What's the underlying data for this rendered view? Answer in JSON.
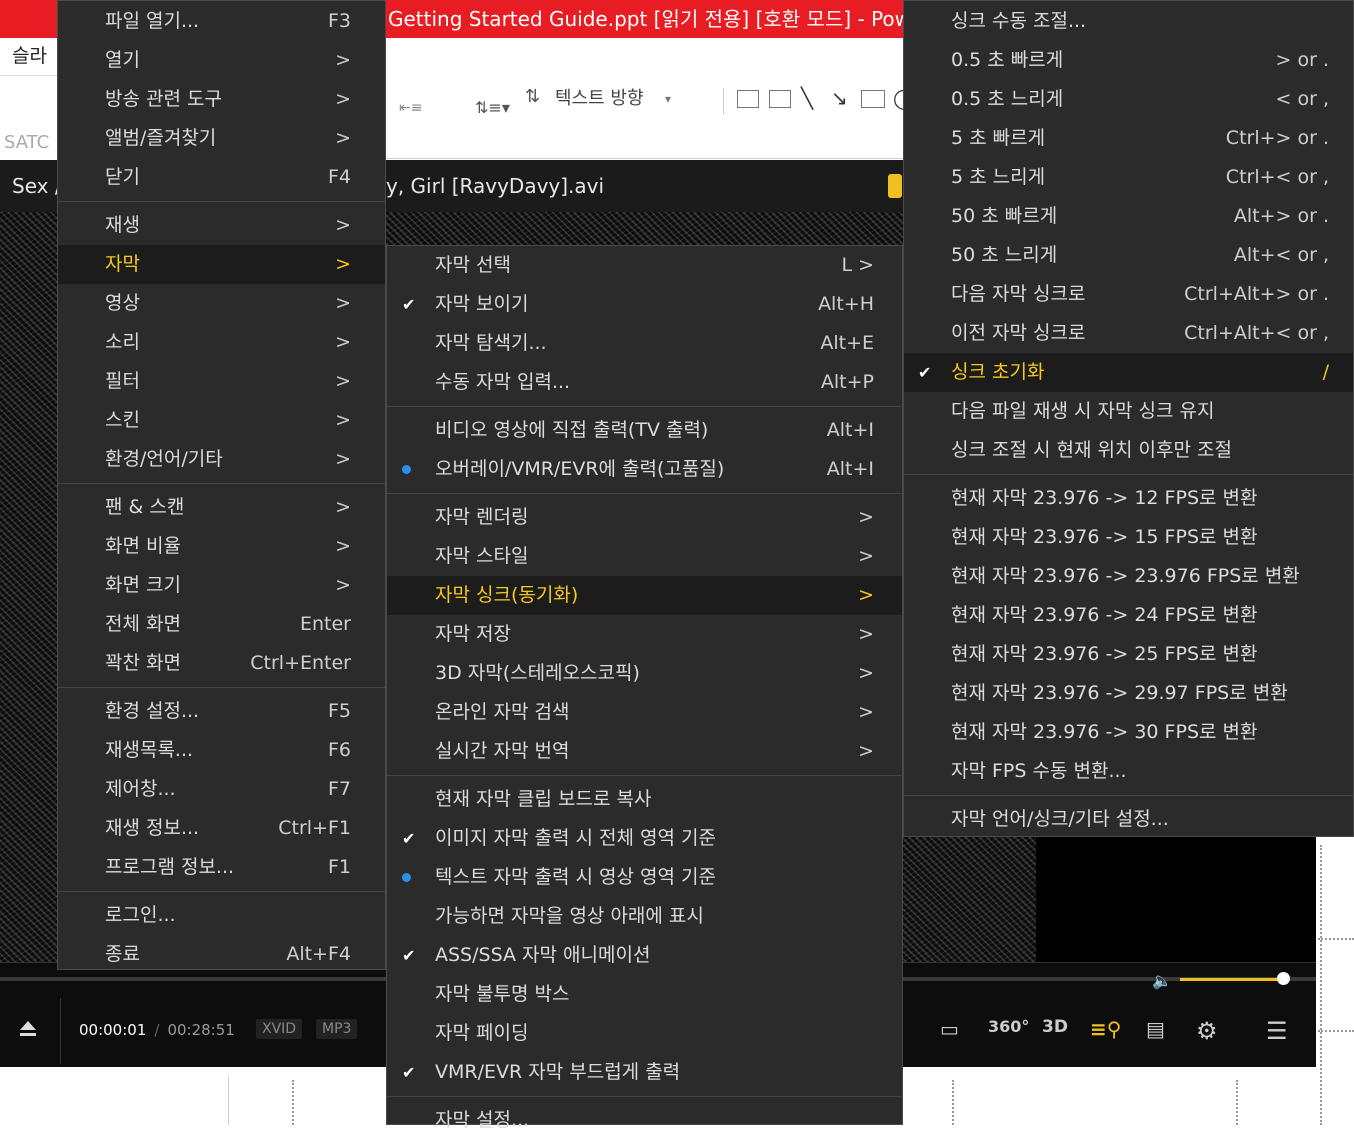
{
  "ppt": {
    "title": "Getting Started Guide.ppt [읽기 전용] [호환 모드] -  Power",
    "slide_tab": "슬라",
    "text_direction": "텍스트 방향",
    "left_label": "SATC"
  },
  "player": {
    "title_left": "Sex /",
    "title_file": "y, Girl [RavyDavy].avi",
    "time_current": "00:00:01",
    "time_separator": "/",
    "time_total": "00:28:51",
    "codec_video": "XVID",
    "codec_audio": "MP3",
    "volume_level": 0.95
  },
  "menu_main": {
    "items": [
      {
        "label": "파일 열기...",
        "shortcut": "F3"
      },
      {
        "label": "열기",
        "shortcut": ">"
      },
      {
        "label": "방송 관련 도구",
        "shortcut": ">"
      },
      {
        "label": "앨범/즐겨찾기",
        "shortcut": ">"
      },
      {
        "label": "닫기",
        "shortcut": "F4"
      },
      {
        "label": "재생",
        "shortcut": ">"
      },
      {
        "label": "자막",
        "shortcut": ">"
      },
      {
        "label": "영상",
        "shortcut": ">"
      },
      {
        "label": "소리",
        "shortcut": ">"
      },
      {
        "label": "필터",
        "shortcut": ">"
      },
      {
        "label": "스킨",
        "shortcut": ">"
      },
      {
        "label": "환경/언어/기타",
        "shortcut": ">"
      },
      {
        "label": "팬 & 스캔",
        "shortcut": ">"
      },
      {
        "label": "화면 비율",
        "shortcut": ">"
      },
      {
        "label": "화면 크기",
        "shortcut": ">"
      },
      {
        "label": "전체 화면",
        "shortcut": "Enter"
      },
      {
        "label": "꽉찬 화면",
        "shortcut": "Ctrl+Enter"
      },
      {
        "label": "환경 설정...",
        "shortcut": "F5"
      },
      {
        "label": "재생목록...",
        "shortcut": "F6"
      },
      {
        "label": "제어창...",
        "shortcut": "F7"
      },
      {
        "label": "재생 정보...",
        "shortcut": "Ctrl+F1"
      },
      {
        "label": "프로그램 정보...",
        "shortcut": "F1"
      },
      {
        "label": "로그인...",
        "shortcut": ""
      },
      {
        "label": "종료",
        "shortcut": "Alt+F4"
      }
    ]
  },
  "menu_subtitle": {
    "items": [
      {
        "label": "자막 선택",
        "shortcut": "L >"
      },
      {
        "label": "자막 보이기",
        "shortcut": "Alt+H"
      },
      {
        "label": "자막 탐색기...",
        "shortcut": "Alt+E"
      },
      {
        "label": "수동 자막 입력...",
        "shortcut": "Alt+P"
      },
      {
        "label": "비디오 영상에 직접 출력(TV 출력)",
        "shortcut": "Alt+I"
      },
      {
        "label": "오버레이/VMR/EVR에 출력(고품질)",
        "shortcut": "Alt+I"
      },
      {
        "label": "자막 렌더링",
        "shortcut": ">"
      },
      {
        "label": "자막 스타일",
        "shortcut": ">"
      },
      {
        "label": "자막 싱크(동기화)",
        "shortcut": ">"
      },
      {
        "label": "자막 저장",
        "shortcut": ">"
      },
      {
        "label": "3D 자막(스테레오스코픽)",
        "shortcut": ">"
      },
      {
        "label": "온라인 자막 검색",
        "shortcut": ">"
      },
      {
        "label": "실시간 자막 번역",
        "shortcut": ">"
      },
      {
        "label": "현재 자막 클립 보드로 복사",
        "shortcut": ""
      },
      {
        "label": "이미지 자막 출력 시 전체 영역 기준",
        "shortcut": ""
      },
      {
        "label": "텍스트 자막 출력 시 영상 영역 기준",
        "shortcut": ""
      },
      {
        "label": "가능하면 자막을 영상 아래에 표시",
        "shortcut": ""
      },
      {
        "label": "ASS/SSA 자막 애니메이션",
        "shortcut": ""
      },
      {
        "label": "자막 불투명 박스",
        "shortcut": ""
      },
      {
        "label": "자막 페이딩",
        "shortcut": ""
      },
      {
        "label": "VMR/EVR 자막 부드럽게 출력",
        "shortcut": ""
      },
      {
        "label": "자막 설정...",
        "shortcut": ""
      }
    ]
  },
  "menu_sync": {
    "items": [
      {
        "label": "싱크 수동 조절...",
        "shortcut": ""
      },
      {
        "label": "0.5 초 빠르게",
        "shortcut": "> or ."
      },
      {
        "label": "0.5 초 느리게",
        "shortcut": "< or ,"
      },
      {
        "label": "5 초 빠르게",
        "shortcut": "Ctrl+> or ."
      },
      {
        "label": "5 초 느리게",
        "shortcut": "Ctrl+< or ,"
      },
      {
        "label": "50 초 빠르게",
        "shortcut": "Alt+> or ."
      },
      {
        "label": "50 초 느리게",
        "shortcut": "Alt+< or ,"
      },
      {
        "label": "다음 자막 싱크로",
        "shortcut": "Ctrl+Alt+> or ."
      },
      {
        "label": "이전 자막 싱크로",
        "shortcut": "Ctrl+Alt+< or ,"
      },
      {
        "label": "싱크 초기화",
        "shortcut": "/"
      },
      {
        "label": "다음 파일 재생 시 자막 싱크 유지",
        "shortcut": ""
      },
      {
        "label": "싱크 조절 시 현재 위치 이후만 조절",
        "shortcut": ""
      },
      {
        "label": "현재 자막 23.976 -> 12 FPS로 변환",
        "shortcut": ""
      },
      {
        "label": "현재 자막 23.976 -> 15 FPS로 변환",
        "shortcut": ""
      },
      {
        "label": "현재 자막 23.976 -> 23.976 FPS로 변환",
        "shortcut": ""
      },
      {
        "label": "현재 자막 23.976 -> 24 FPS로 변환",
        "shortcut": ""
      },
      {
        "label": "현재 자막 23.976 -> 25 FPS로 변환",
        "shortcut": ""
      },
      {
        "label": "현재 자막 23.976 -> 29.97 FPS로 변환",
        "shortcut": ""
      },
      {
        "label": "현재 자막 23.976 -> 30 FPS로 변환",
        "shortcut": ""
      },
      {
        "label": "자막 FPS 수동 변환...",
        "shortcut": ""
      },
      {
        "label": "자막 언어/싱크/기타 설정...",
        "shortcut": ""
      }
    ]
  },
  "colors": {
    "menu_bg": "#2b2b2b",
    "highlight_text": "#f7c81e",
    "ppt_title_bar": "#e81d23",
    "radio_dot": "#2b8eea"
  }
}
